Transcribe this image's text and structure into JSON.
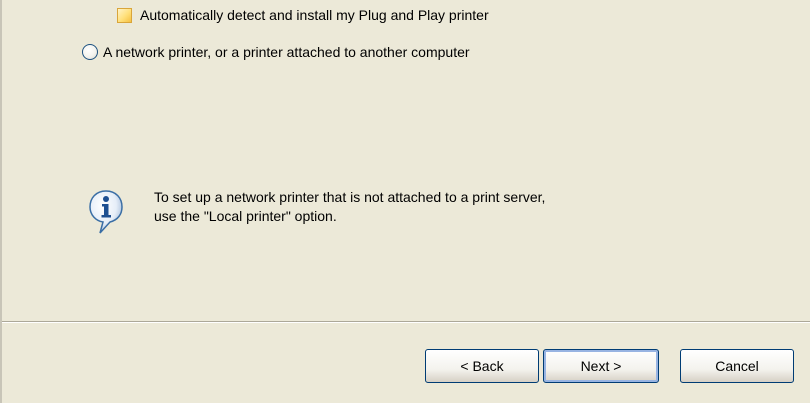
{
  "options": {
    "auto_detect_label": "Automatically detect and install my Plug and Play printer",
    "network_printer_label": "A network printer, or a printer attached to another computer"
  },
  "info": {
    "line1": "To set up a network printer that is not attached to a print server,",
    "line2": "use the \"Local printer\" option."
  },
  "buttons": {
    "back": "< Back",
    "next": "Next >",
    "cancel": "Cancel"
  },
  "icons": {
    "info": "info-icon"
  }
}
